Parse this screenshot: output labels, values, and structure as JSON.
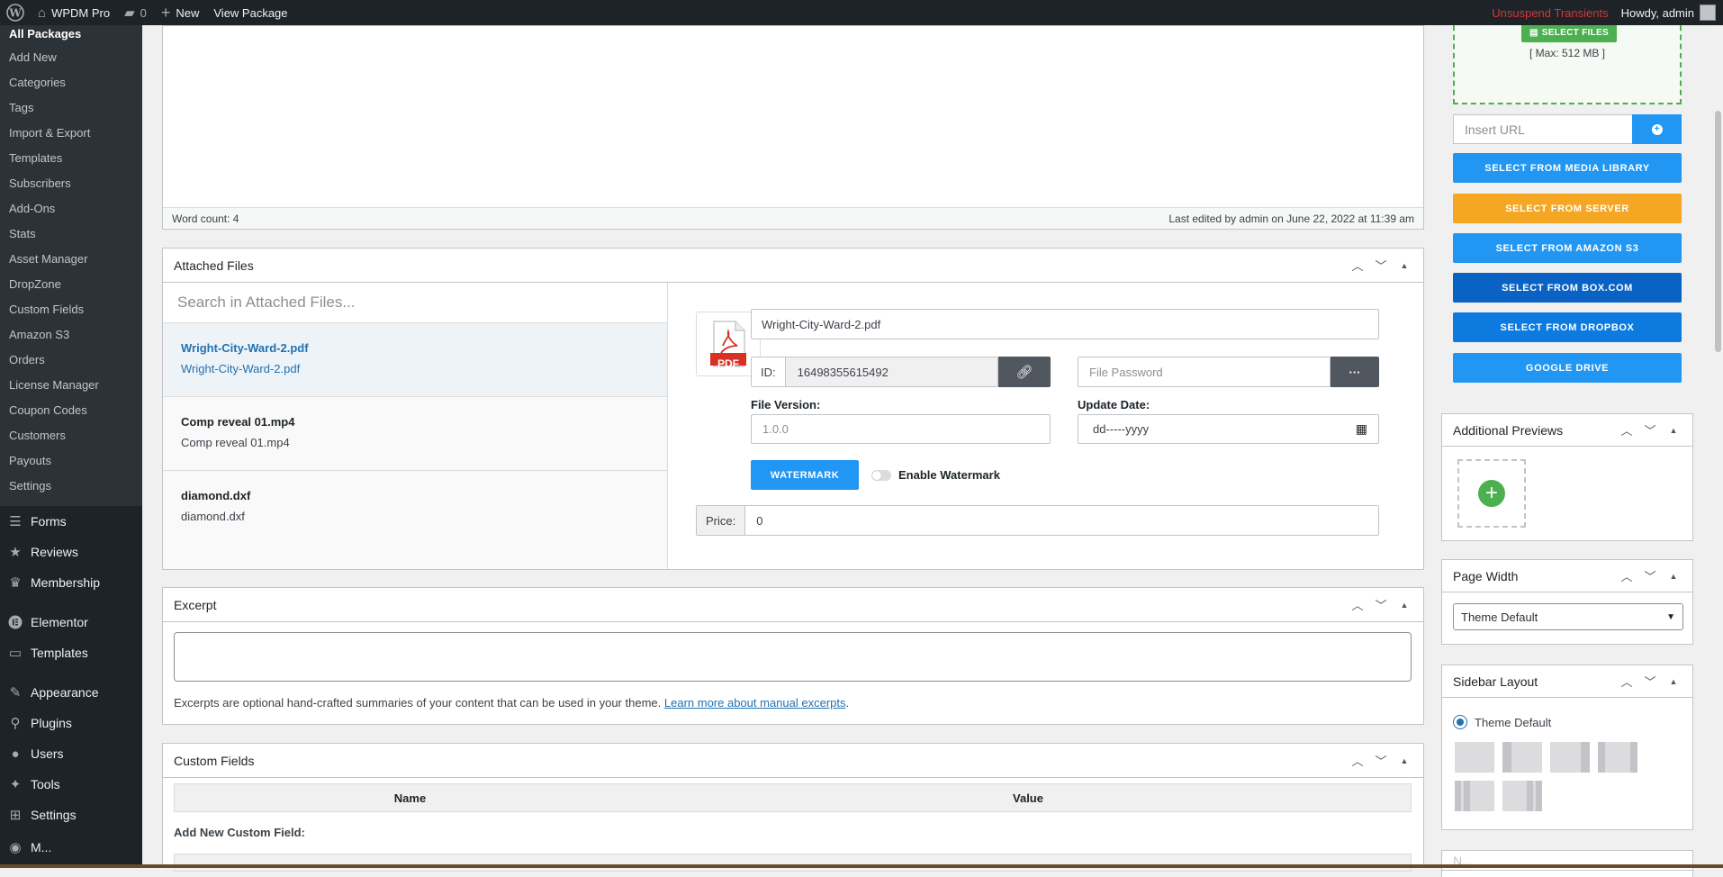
{
  "adminbar": {
    "site": "WPDM Pro",
    "comments": "0",
    "new": "New",
    "view": "View Package",
    "transients": "Unsuspend Transients",
    "howdy": "Howdy, admin"
  },
  "submenu": [
    "All Packages",
    "Add New",
    "Categories",
    "Tags",
    "Import & Export",
    "Templates",
    "Subscribers",
    "Add-Ons",
    "Stats",
    "Asset Manager",
    "DropZone",
    "Custom Fields",
    "Amazon S3",
    "Orders",
    "License Manager",
    "Coupon Codes",
    "Customers",
    "Payouts",
    "Settings"
  ],
  "menu": {
    "forms": "Forms",
    "reviews": "Reviews",
    "membership": "Membership",
    "elementor": "Elementor",
    "templates": "Templates",
    "appearance": "Appearance",
    "plugins": "Plugins",
    "users": "Users",
    "tools": "Tools",
    "settings": "Settings",
    "more": "M..."
  },
  "editor": {
    "word_count": "Word count: 4",
    "last_edited": "Last edited by admin on June 22, 2022 at 11:39 am"
  },
  "attached": {
    "title": "Attached Files",
    "search_placeholder": "Search in Attached Files...",
    "files": [
      {
        "name": "Wright-City-Ward-2.pdf",
        "sub": "Wright-City-Ward-2.pdf"
      },
      {
        "name": "Comp reveal 01.mp4",
        "sub": "Comp reveal 01.mp4"
      },
      {
        "name": "diamond.dxf",
        "sub": "diamond.dxf"
      }
    ],
    "detail": {
      "pdf_label": "PDF",
      "title_value": "Wright-City-Ward-2.pdf",
      "id_label": "ID:",
      "id_value": "16498355615492",
      "password_placeholder": "File Password",
      "password_btn": "···",
      "version_label": "File Version:",
      "version_placeholder": "1.0.0",
      "date_label": "Update Date:",
      "date_placeholder": "dd-----yyyy",
      "watermark_btn": "WATERMARK",
      "enable_watermark": "Enable Watermark",
      "price_label": "Price:",
      "price_value": "0"
    }
  },
  "excerpt": {
    "title": "Excerpt",
    "help": "Excerpts are optional hand-crafted summaries of your content that can be used in your theme.",
    "link": "Learn more about manual excerpts",
    "period": "."
  },
  "custom_fields": {
    "title": "Custom Fields",
    "col_name": "Name",
    "col_value": "Value",
    "add_new": "Add New Custom Field:"
  },
  "upload": {
    "select_files": "SELECT FILES",
    "max": "[ Max: 512 MB ]",
    "url_placeholder": "Insert URL",
    "buttons": [
      {
        "label": "SELECT FROM MEDIA LIBRARY",
        "color": "#2196f3"
      },
      {
        "label": "SELECT FROM SERVER",
        "color": "#f5a623"
      },
      {
        "label": "SELECT FROM AMAZON S3",
        "color": "#2196f3"
      },
      {
        "label": "SELECT FROM BOX.COM",
        "color": "#0a62c4"
      },
      {
        "label": "SELECT FROM DROPBOX",
        "color": "#0d7ae0"
      },
      {
        "label": "GOOGLE DRIVE",
        "color": "#2196f3"
      }
    ]
  },
  "previews": {
    "title": "Additional Previews"
  },
  "page_width": {
    "title": "Page Width",
    "selected": "Theme Default"
  },
  "sidebar_layout": {
    "title": "Sidebar Layout",
    "selected": "Theme Default"
  },
  "next_box": {
    "title": "N..."
  }
}
